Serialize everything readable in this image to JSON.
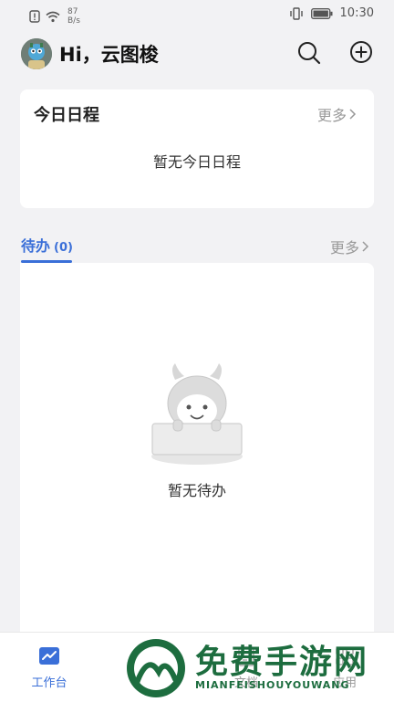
{
  "status_bar": {
    "speed_value": "87",
    "speed_unit": "B/s",
    "time": "10:30"
  },
  "header": {
    "greeting": "Hi，云图梭",
    "search_icon": "search-icon",
    "add_icon": "plus-circle-icon"
  },
  "today_schedule": {
    "title": "今日日程",
    "more_label": "更多",
    "empty_text": "暂无今日日程"
  },
  "todo": {
    "tab_label": "待办",
    "tab_count": "(0)",
    "more_label": "更多",
    "empty_text": "暂无待办"
  },
  "bottom_nav": {
    "items": [
      {
        "label": "工作台",
        "icon": "workbench-chart-icon",
        "active": true
      },
      {
        "label": "",
        "icon": "unknown-icon",
        "active": false
      },
      {
        "label": "文档",
        "icon": "document-icon",
        "active": false
      },
      {
        "label": "应用",
        "icon": "apps-icon",
        "active": false
      }
    ]
  },
  "watermark": {
    "title": "免费手游网",
    "subtitle": "MIANFEISHOUYOUWANG"
  },
  "colors": {
    "accent": "#3a6fd8",
    "background": "#f2f2f4",
    "watermark": "#1d6d3f"
  }
}
